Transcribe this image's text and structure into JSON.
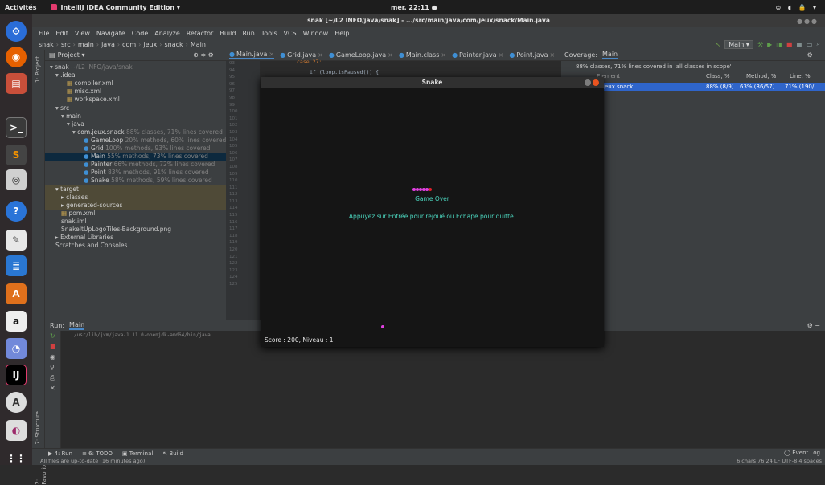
{
  "system": {
    "activities": "Activités",
    "app_name": "IntelliJ IDEA Community Edition ▾",
    "clock": "mer. 22:11 ●",
    "tray": "⊜ ◖ 🔒 ▾"
  },
  "window": {
    "title": "snak [~/L2 INFO/java/snak] - .../src/main/java/com/jeux/snack/Main.java"
  },
  "menu": [
    "File",
    "Edit",
    "View",
    "Navigate",
    "Code",
    "Analyze",
    "Refactor",
    "Build",
    "Run",
    "Tools",
    "VCS",
    "Window",
    "Help"
  ],
  "nav": {
    "crumbs": [
      "snak",
      "src",
      "main",
      "java",
      "com",
      "jeux",
      "snack",
      "Main"
    ],
    "run_config": "Main ▾"
  },
  "sidebar": {
    "project_label": "1: Project",
    "structure_label": "7: Structure",
    "favorites_label": "2: Favorites"
  },
  "project": {
    "header": "Project ▾",
    "nodes": [
      {
        "t": "▾ snak",
        "g": " ~/L2 INFO/java/snak",
        "d": 0,
        "k": "root"
      },
      {
        "t": "▾ .idea",
        "g": "",
        "d": 1,
        "k": "folder"
      },
      {
        "t": "compiler.xml",
        "g": "",
        "d": 3,
        "k": "xml"
      },
      {
        "t": "misc.xml",
        "g": "",
        "d": 3,
        "k": "xml"
      },
      {
        "t": "workspace.xml",
        "g": "",
        "d": 3,
        "k": "xml"
      },
      {
        "t": "▾ src",
        "g": "",
        "d": 1,
        "k": "folder"
      },
      {
        "t": "▾ main",
        "g": "",
        "d": 2,
        "k": "folder"
      },
      {
        "t": "▾ java",
        "g": "",
        "d": 3,
        "k": "folder"
      },
      {
        "t": "▾ com.jeux.snack",
        "g": " 88% classes, 71% lines covered",
        "d": 4,
        "k": "pkg"
      },
      {
        "t": "GameLoop",
        "g": " 20% methods, 60% lines covered",
        "d": 6,
        "k": "cls"
      },
      {
        "t": "Grid",
        "g": " 100% methods, 93% lines covered",
        "d": 6,
        "k": "cls"
      },
      {
        "t": "Main",
        "g": " 55% methods, 73% lines covered",
        "d": 6,
        "k": "cls",
        "sel": true
      },
      {
        "t": "Painter",
        "g": " 66% methods, 72% lines covered",
        "d": 6,
        "k": "cls"
      },
      {
        "t": "Point",
        "g": " 83% methods, 91% lines covered",
        "d": 6,
        "k": "cls"
      },
      {
        "t": "Snake",
        "g": " 58% methods, 59% lines covered",
        "d": 6,
        "k": "cls"
      },
      {
        "t": "▾ target",
        "g": "",
        "d": 1,
        "k": "folder",
        "hl": true
      },
      {
        "t": "▸ classes",
        "g": "",
        "d": 2,
        "k": "folder",
        "hl": true
      },
      {
        "t": "▸ generated-sources",
        "g": "",
        "d": 2,
        "k": "folder",
        "hl": true
      },
      {
        "t": "pom.xml",
        "g": "",
        "d": 2,
        "k": "xml"
      },
      {
        "t": "snak.iml",
        "g": "",
        "d": 2,
        "k": "file"
      },
      {
        "t": "SnakeItUpLogoTiles-Background.png",
        "g": "",
        "d": 2,
        "k": "file"
      },
      {
        "t": "▸ External Libraries",
        "g": "",
        "d": 1,
        "k": "lib"
      },
      {
        "t": "Scratches and Consoles",
        "g": "",
        "d": 1,
        "k": "lib"
      }
    ]
  },
  "tabs": [
    {
      "label": "Main.java",
      "active": true
    },
    {
      "label": "Grid.java",
      "active": false
    },
    {
      "label": "GameLoop.java",
      "active": false
    },
    {
      "label": "Main.class",
      "active": false
    },
    {
      "label": "Painter.java",
      "active": false
    },
    {
      "label": "Point.java",
      "active": false
    }
  ],
  "editor": {
    "code_line1": "case 27:",
    "code_line2": "if (loop.isPaused()) {",
    "line_numbers": [
      "93",
      "94",
      "95",
      "96",
      "97",
      "98",
      "99",
      "100",
      "101",
      "102",
      "103",
      "104",
      "105",
      "106",
      "107",
      "108",
      "109",
      "110",
      "111",
      "112",
      "113",
      "114",
      "115",
      "116",
      "117",
      "118",
      "119",
      "120",
      "121",
      "122",
      "123",
      "124",
      "125"
    ]
  },
  "coverage": {
    "header": "Coverage:",
    "tab": "Main",
    "summary": "88% classes, 71% lines covered in 'all classes in scope'",
    "col_element": "Element",
    "col_class": "Class, %",
    "col_method": "Method, %",
    "col_line": "Line, %",
    "row_name": "jeux.snack",
    "row_class": "88% (8/9)",
    "row_method": "63% (36/57)",
    "row_line": "71% (190/..."
  },
  "run": {
    "label": "Run:",
    "tab": "Main",
    "cmd": "/usr/lib/jvm/java-1.11.0-openjdk-amd64/bin/java ..."
  },
  "bottom": {
    "run": "▶ 4: Run",
    "todo": "≡ 6: TODO",
    "terminal": "▣ Terminal",
    "build": "↖ Build",
    "event_log": "◯ Event Log",
    "status": "All files are up-to-date (16 minutes ago)",
    "status_right": "6 chars   76:24   LF   UTF-8   4 spaces"
  },
  "snake_window": {
    "title": "Snake",
    "game_over": "Game Over",
    "message": "Appuyez sur Entrée pour rejoué ou Echape pour quitte.",
    "score": "Score : 200, Niveau : 1",
    "body_color": "#e040e0",
    "head_color": "#e0202a",
    "text_color": "#4cd8c0"
  }
}
